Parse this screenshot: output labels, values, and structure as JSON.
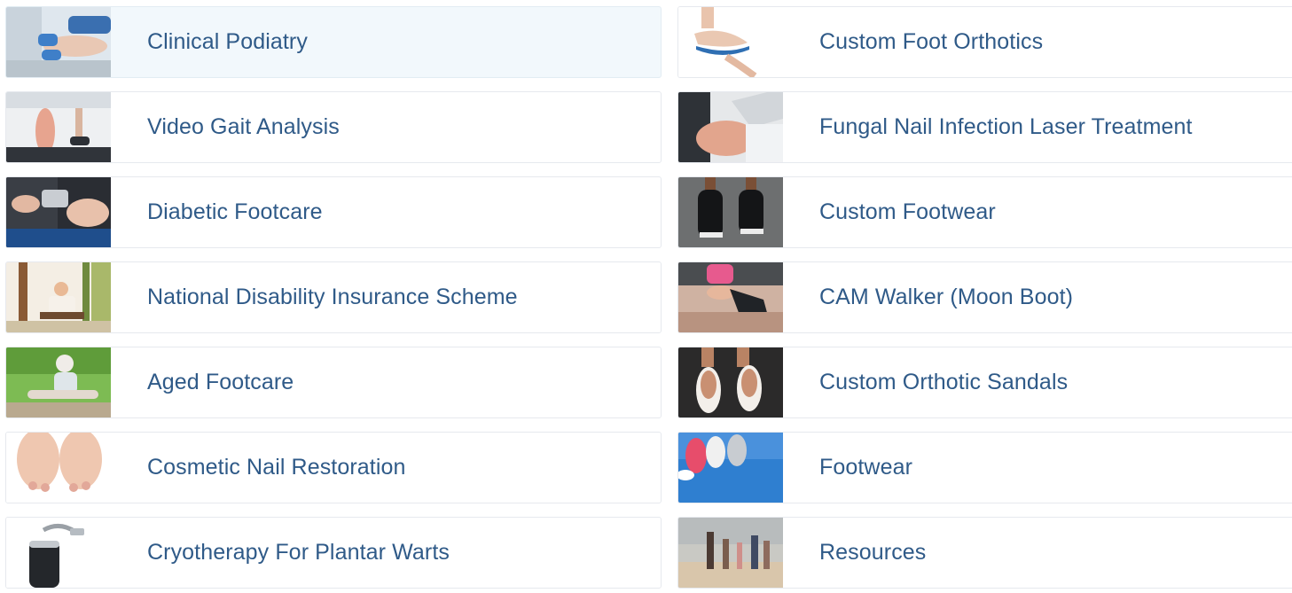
{
  "colors": {
    "link": "#2f5a88",
    "card_border": "#e6e9ee",
    "card_active_bg": "#f2f8fc"
  },
  "services_left": [
    {
      "label": "Clinical Podiatry",
      "icon": "podiatry-treatment-photo"
    },
    {
      "label": "Video Gait Analysis",
      "icon": "treadmill-feet-photo"
    },
    {
      "label": "Diabetic Footcare",
      "icon": "foot-examination-photo"
    },
    {
      "label": "National Disability Insurance Scheme",
      "icon": "park-swing-photo"
    },
    {
      "label": "Aged Footcare",
      "icon": "elderly-woman-stretching-photo"
    },
    {
      "label": "Cosmetic Nail Restoration",
      "icon": "bare-feet-photo"
    },
    {
      "label": "Cryotherapy For Plantar Warts",
      "icon": "cryo-device-photo"
    }
  ],
  "services_right": [
    {
      "label": "Custom Foot Orthotics",
      "icon": "orthotic-insole-photo"
    },
    {
      "label": "Fungal Nail Infection Laser Treatment",
      "icon": "laser-treatment-photo"
    },
    {
      "label": "Custom Footwear",
      "icon": "black-shoes-photo"
    },
    {
      "label": "CAM Walker (Moon Boot)",
      "icon": "moon-boot-photo"
    },
    {
      "label": "Custom Orthotic Sandals",
      "icon": "sandals-photo"
    },
    {
      "label": "Footwear",
      "icon": "sneakers-photo"
    },
    {
      "label": "Resources",
      "icon": "family-beach-walk-photo"
    }
  ]
}
